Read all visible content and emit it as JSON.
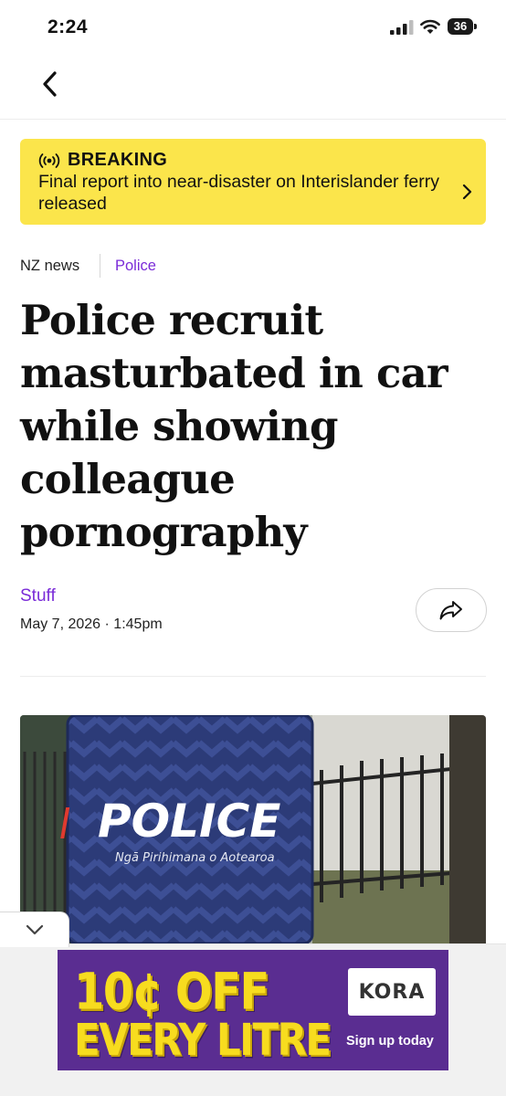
{
  "status_bar": {
    "time": "2:24",
    "battery_level": "36"
  },
  "nav": {
    "back_icon": "chevron-left-icon"
  },
  "breaking": {
    "label": "BREAKING",
    "text": "Final report into near-disaster on Interislander ferry released",
    "icon": "broadcast-icon",
    "background_color": "#fbe54b"
  },
  "breadcrumbs": {
    "section": "NZ news",
    "topic": "Police",
    "topic_color": "#7a2bd8"
  },
  "article": {
    "headline": "Police recruit masturbated in car while showing colleague pornography",
    "author": "Stuff",
    "date": "May 7, 2026",
    "separator": "·",
    "time": "1:45pm",
    "share_icon": "share-arrow-icon"
  },
  "hero_image": {
    "sign_text": "POLICE",
    "sign_subtitle": "Ngā Pirihimana o Aotearoa"
  },
  "ad": {
    "headline_line1": "10¢ OFF",
    "headline_line2": "EVERY LITRE",
    "brand": "KORA",
    "cta": "Sign up today",
    "background_color": "#5a2d91",
    "headline_color": "#f7dc1f"
  }
}
